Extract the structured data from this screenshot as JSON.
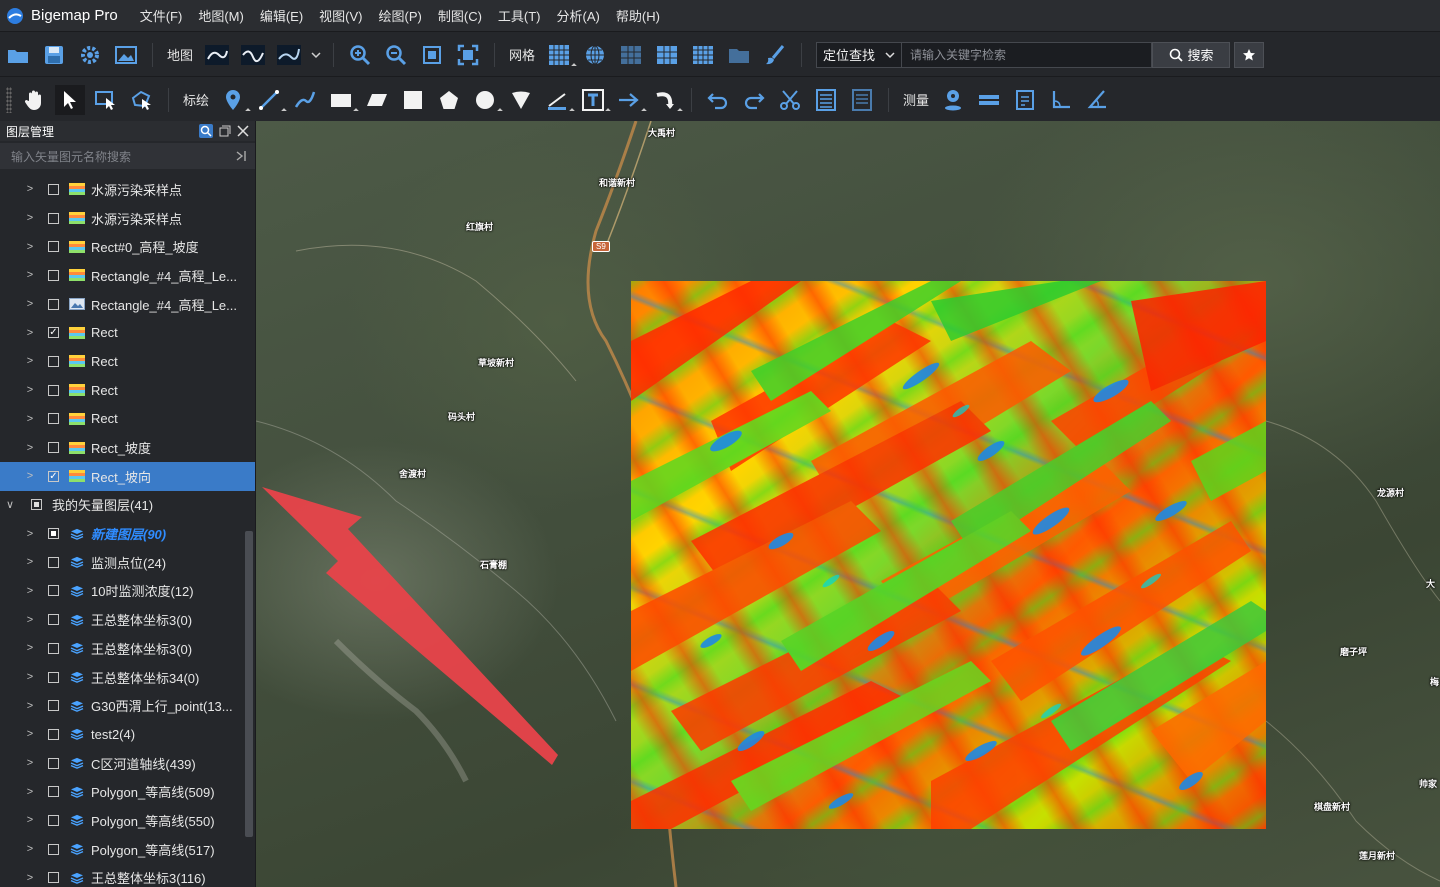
{
  "app": {
    "title": "Bigemap Pro"
  },
  "menu": [
    "文件(F)",
    "地图(M)",
    "编辑(E)",
    "视图(V)",
    "绘图(P)",
    "制图(C)",
    "工具(T)",
    "分析(A)",
    "帮助(H)"
  ],
  "toolbar1": {
    "map_label": "地图",
    "grid_label": "网格",
    "locate_select": "定位查找",
    "search_placeholder": "请输入关键字检索",
    "search_button": "搜索"
  },
  "toolbar2": {
    "draw_label": "标绘",
    "measure_label": "测量"
  },
  "panel": {
    "title": "图层管理",
    "filter_placeholder": "输入矢量图元名称搜索",
    "layers": [
      {
        "label": "水源污染采样点",
        "checked": false,
        "type": "raster"
      },
      {
        "label": "水源污染采样点",
        "checked": false,
        "type": "raster"
      },
      {
        "label": "Rect#0_高程_坡度",
        "checked": false,
        "type": "raster"
      },
      {
        "label": "Rectangle_#4_高程_Le...",
        "checked": false,
        "type": "raster"
      },
      {
        "label": "Rectangle_#4_高程_Le...",
        "checked": false,
        "type": "image"
      },
      {
        "label": "Rect",
        "checked": true,
        "type": "raster"
      },
      {
        "label": "Rect",
        "checked": false,
        "type": "raster"
      },
      {
        "label": "Rect",
        "checked": false,
        "type": "raster"
      },
      {
        "label": "Rect",
        "checked": false,
        "type": "raster"
      },
      {
        "label": "Rect_坡度",
        "checked": false,
        "type": "raster"
      },
      {
        "label": "Rect_坡向",
        "checked": true,
        "type": "raster",
        "selected": true
      }
    ],
    "group": {
      "label": "我的矢量图层(41)"
    },
    "vector_layers": [
      {
        "label": "新建图层(90)",
        "checked": true,
        "highlight": true
      },
      {
        "label": "监测点位(24)",
        "checked": false
      },
      {
        "label": "10时监测浓度(12)",
        "checked": false
      },
      {
        "label": "王总整体坐标3(0)",
        "checked": false
      },
      {
        "label": "王总整体坐标3(0)",
        "checked": false
      },
      {
        "label": "王总整体坐标34(0)",
        "checked": false
      },
      {
        "label": "G30西渭上行_point(13...",
        "checked": false
      },
      {
        "label": "test2(4)",
        "checked": false
      },
      {
        "label": "C区河道轴线(439)",
        "checked": false
      },
      {
        "label": "Polygon_等高线(509)",
        "checked": false
      },
      {
        "label": "Polygon_等高线(550)",
        "checked": false
      },
      {
        "label": "Polygon_等高线(517)",
        "checked": false
      },
      {
        "label": "王总整体坐标3(116)",
        "checked": false
      }
    ]
  },
  "map": {
    "road": "S9",
    "villages": [
      "大禹村",
      "和谐新村",
      "红旗村",
      "草坡新村",
      "码头村",
      "舍渡村",
      "石膏棚",
      "龙源村",
      "大",
      "磨子坪",
      "梅",
      "帅家",
      "棋盘新村",
      "莲月新村"
    ]
  },
  "colors": {
    "accent": "#3a7bc8",
    "arrow": "#e8434a",
    "highlight_text": "#2f8cff"
  }
}
